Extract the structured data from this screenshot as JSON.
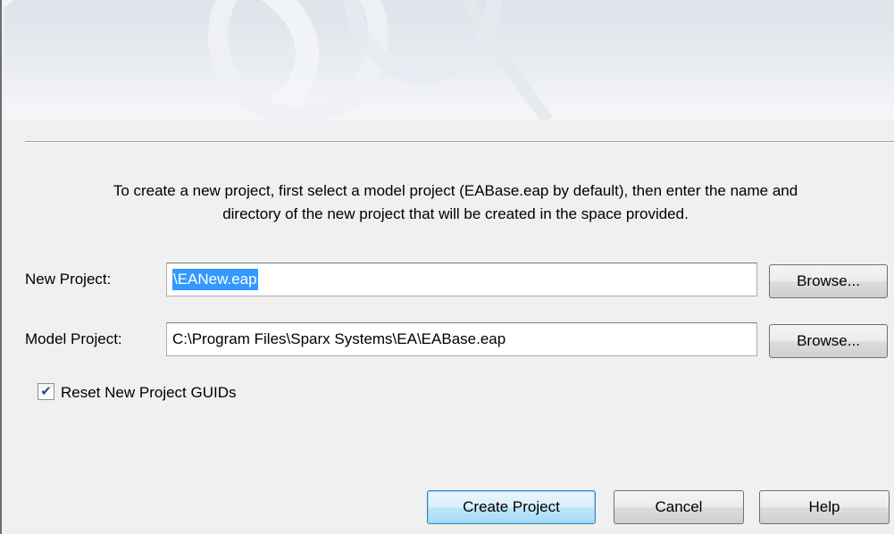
{
  "intro": {
    "line1": "To create a new project, first select a model project (EABase.eap by default), then enter the name and",
    "line2": "directory of the new project that will be created in the space provided."
  },
  "new_project": {
    "label": "New Project:",
    "value": "\\EANew.eap",
    "browse_label": "Browse..."
  },
  "model_project": {
    "label": "Model Project:",
    "value": "C:\\Program Files\\Sparx Systems\\EA\\EABase.eap",
    "browse_label": "Browse..."
  },
  "reset_guids": {
    "label": "Reset New Project GUIDs",
    "checked": true
  },
  "buttons": {
    "create": "Create Project",
    "cancel": "Cancel",
    "help": "Help"
  },
  "icons": {
    "checkmark": "check-icon"
  }
}
